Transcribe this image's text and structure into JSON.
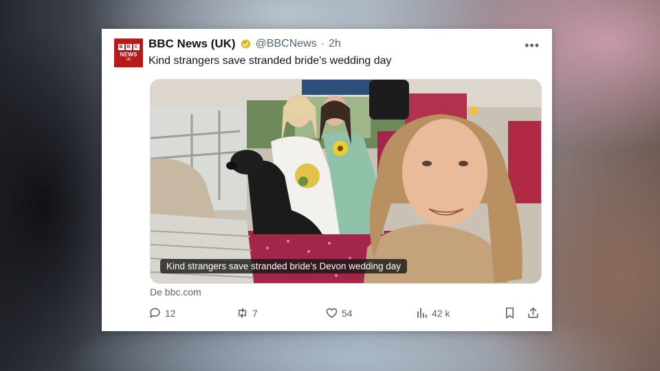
{
  "account": {
    "display_name": "BBC News (UK)",
    "handle": "@BBCNews",
    "time": "2h",
    "avatar_letters": [
      "B",
      "B",
      "C"
    ],
    "avatar_news": "NEWS",
    "avatar_uk": "UK"
  },
  "tweet": {
    "text": "Kind strangers save stranded bride's wedding day",
    "media_caption": "Kind strangers save stranded bride's Devon wedding day",
    "source": "De bbc.com"
  },
  "actions": {
    "replies": "12",
    "reposts": "7",
    "likes": "54",
    "views": "42 k"
  },
  "icons": {
    "verified": "verified-badge-icon",
    "more": "more-icon",
    "reply": "reply-icon",
    "repost": "repost-icon",
    "like": "like-icon",
    "views": "views-icon",
    "bookmark": "bookmark-icon",
    "share": "share-icon"
  },
  "colors": {
    "brand_red": "#b8191b",
    "verified_gold": "#e2b719",
    "muted_text": "#536471"
  }
}
